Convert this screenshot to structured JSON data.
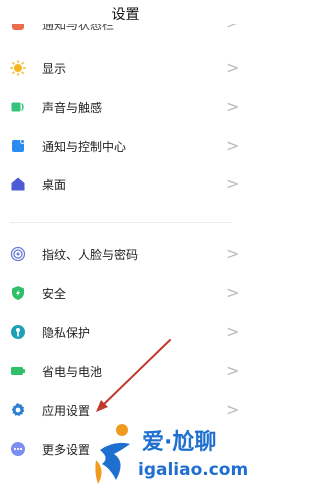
{
  "header": {
    "title": "设置"
  },
  "partial_item": {
    "label": "通知与状态栏"
  },
  "group1": [
    {
      "label": "显示",
      "icon": "sun-icon"
    },
    {
      "label": "声音与触感",
      "icon": "speaker-icon"
    },
    {
      "label": "通知与控制中心",
      "icon": "notification-icon"
    },
    {
      "label": "桌面",
      "icon": "home-icon"
    }
  ],
  "group2": [
    {
      "label": "指纹、人脸与密码",
      "icon": "fingerprint-icon"
    },
    {
      "label": "安全",
      "icon": "shield-icon"
    },
    {
      "label": "隐私保护",
      "icon": "privacy-icon"
    },
    {
      "label": "省电与电池",
      "icon": "battery-icon"
    },
    {
      "label": "应用设置",
      "icon": "gear-icon"
    },
    {
      "label": "更多设置",
      "icon": "more-icon"
    }
  ],
  "chevron": ">",
  "watermark": {
    "brand": "爱·尬聊",
    "domain": "igaliao.com"
  },
  "colors": {
    "sun": "#f5b51e",
    "speaker": "#35c27a",
    "notification": "#2a8bf2",
    "home": "#4d5bd6",
    "fingerprint": "#6a7bd8",
    "shield": "#2fbf68",
    "privacy": "#1fa0b8",
    "battery": "#2fbf68",
    "gear": "#2a7fd4",
    "more": "#7c8df0",
    "arrow": "#c0392b",
    "watermark_blue": "#1f6fd0",
    "watermark_orange": "#f29a1f"
  }
}
